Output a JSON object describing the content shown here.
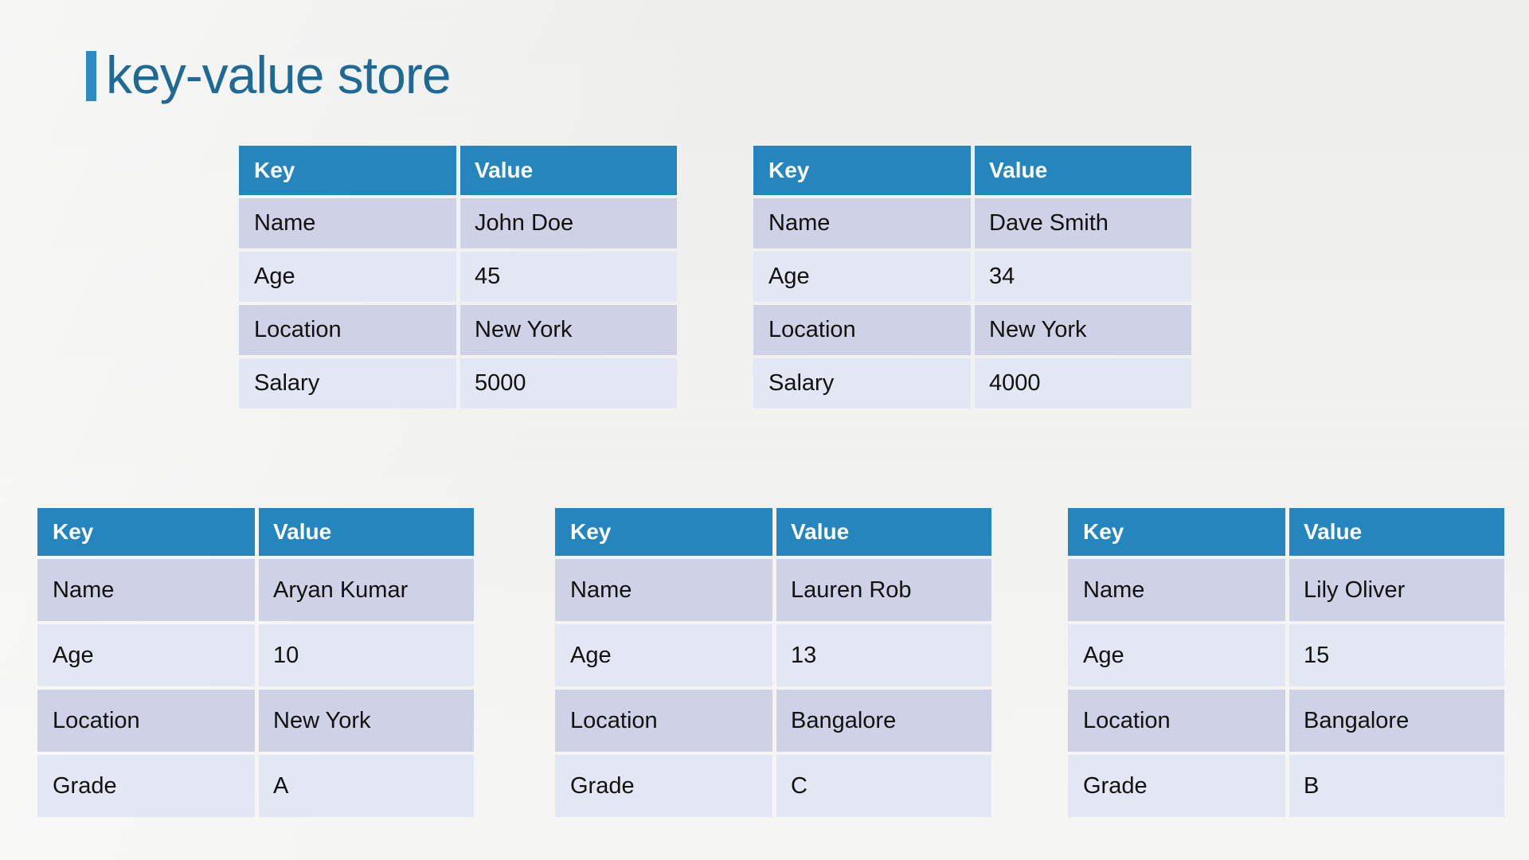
{
  "page": {
    "title": "key-value store",
    "accent_bar_color": "#2e8bc4",
    "title_color": "#1f6a94",
    "background_color": "#f1f1ef"
  },
  "table_style": {
    "header_background": "#2586be",
    "header_text_color": "#ffffff",
    "row_band_a": "#cfd2e6",
    "row_band_b": "#e3e6f3",
    "cell_text_color": "#111111"
  },
  "columns": [
    "Key",
    "Value"
  ],
  "tables": [
    {
      "id": "table-0",
      "headers": [
        "Key",
        "Value"
      ],
      "rows": [
        [
          "Name",
          "John Doe"
        ],
        [
          "Age",
          "45"
        ],
        [
          "Location",
          "New York"
        ],
        [
          "Salary",
          "5000"
        ]
      ]
    },
    {
      "id": "table-1",
      "headers": [
        "Key",
        "Value"
      ],
      "rows": [
        [
          "Name",
          "Dave Smith"
        ],
        [
          "Age",
          "34"
        ],
        [
          "Location",
          "New York"
        ],
        [
          "Salary",
          "4000"
        ]
      ]
    },
    {
      "id": "table-2",
      "headers": [
        "Key",
        "Value"
      ],
      "rows": [
        [
          "Name",
          "Aryan Kumar"
        ],
        [
          "Age",
          "10"
        ],
        [
          "Location",
          "New York"
        ],
        [
          "Grade",
          "A"
        ]
      ]
    },
    {
      "id": "table-3",
      "headers": [
        "Key",
        "Value"
      ],
      "rows": [
        [
          "Name",
          "Lauren Rob"
        ],
        [
          "Age",
          "13"
        ],
        [
          "Location",
          "Bangalore"
        ],
        [
          "Grade",
          "C"
        ]
      ]
    },
    {
      "id": "table-4",
      "headers": [
        "Key",
        "Value"
      ],
      "rows": [
        [
          "Name",
          "Lily Oliver"
        ],
        [
          "Age",
          "15"
        ],
        [
          "Location",
          "Bangalore"
        ],
        [
          "Grade",
          "B"
        ]
      ]
    }
  ]
}
